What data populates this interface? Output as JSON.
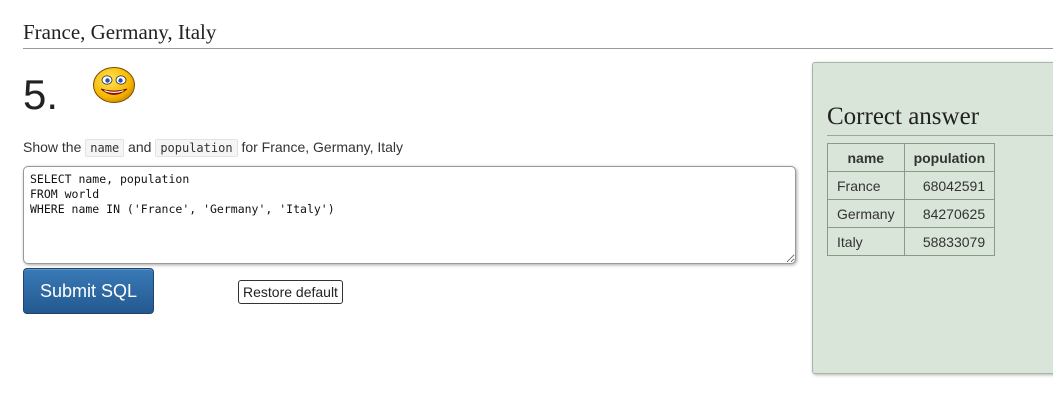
{
  "section": {
    "title": "France, Germany, Italy"
  },
  "question": {
    "number": "5.",
    "text_before": "Show the ",
    "code1": "name",
    "text_middle": " and ",
    "code2": "population",
    "text_after": " for France, Germany, Italy",
    "status_icon": "smiley-correct-icon"
  },
  "editor": {
    "value": "SELECT name, population\nFROM world\nWHERE name IN ('France', 'Germany', 'Italy')"
  },
  "buttons": {
    "submit_label": "Submit SQL",
    "restore_label": "Restore default"
  },
  "answer": {
    "title": "Correct answer",
    "columns": [
      "name",
      "population"
    ],
    "rows": [
      [
        "France",
        "68042591"
      ],
      [
        "Germany",
        "84270625"
      ],
      [
        "Italy",
        "58833079"
      ]
    ]
  },
  "colors": {
    "submit_button": "#2d6aa3",
    "answer_panel_bg": "#d9e5d8",
    "smiley_face": "#f6b800"
  }
}
